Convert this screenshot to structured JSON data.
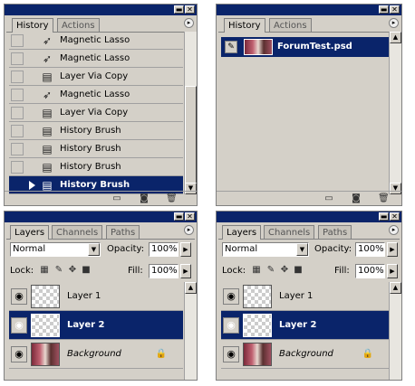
{
  "history_panel_left": {
    "tabs": [
      {
        "label": "History"
      },
      {
        "label": "Actions"
      }
    ],
    "items": [
      {
        "label": "Magnetic Lasso",
        "icon": "lasso-icon"
      },
      {
        "label": "Magnetic Lasso",
        "icon": "lasso-icon"
      },
      {
        "label": "Layer Via Copy",
        "icon": "state-icon"
      },
      {
        "label": "Magnetic Lasso",
        "icon": "lasso-icon"
      },
      {
        "label": "Layer Via Copy",
        "icon": "state-icon"
      },
      {
        "label": "History Brush",
        "icon": "state-icon"
      },
      {
        "label": "History Brush",
        "icon": "state-icon"
      },
      {
        "label": "History Brush",
        "icon": "state-icon"
      },
      {
        "label": "History Brush",
        "icon": "state-icon",
        "selected": true
      }
    ]
  },
  "history_panel_right": {
    "tabs": [
      {
        "label": "History"
      },
      {
        "label": "Actions"
      }
    ],
    "snapshot_label": "ForumTest.psd"
  },
  "layers_panel": {
    "tabs": [
      {
        "label": "Layers"
      },
      {
        "label": "Channels"
      },
      {
        "label": "Paths"
      }
    ],
    "blend_mode": "Normal",
    "opacity_label": "Opacity:",
    "opacity_value": "100%",
    "lock_label": "Lock:",
    "fill_label": "Fill:",
    "fill_value": "100%",
    "layers": [
      {
        "name": "Layer 1"
      },
      {
        "name": "Layer 2",
        "selected": true
      },
      {
        "name": "Background",
        "italic": true,
        "locked": true
      }
    ]
  },
  "colors": {
    "selection": "#0a246a",
    "panel": "#d4d0c8",
    "titlebar": "#0a246a"
  }
}
